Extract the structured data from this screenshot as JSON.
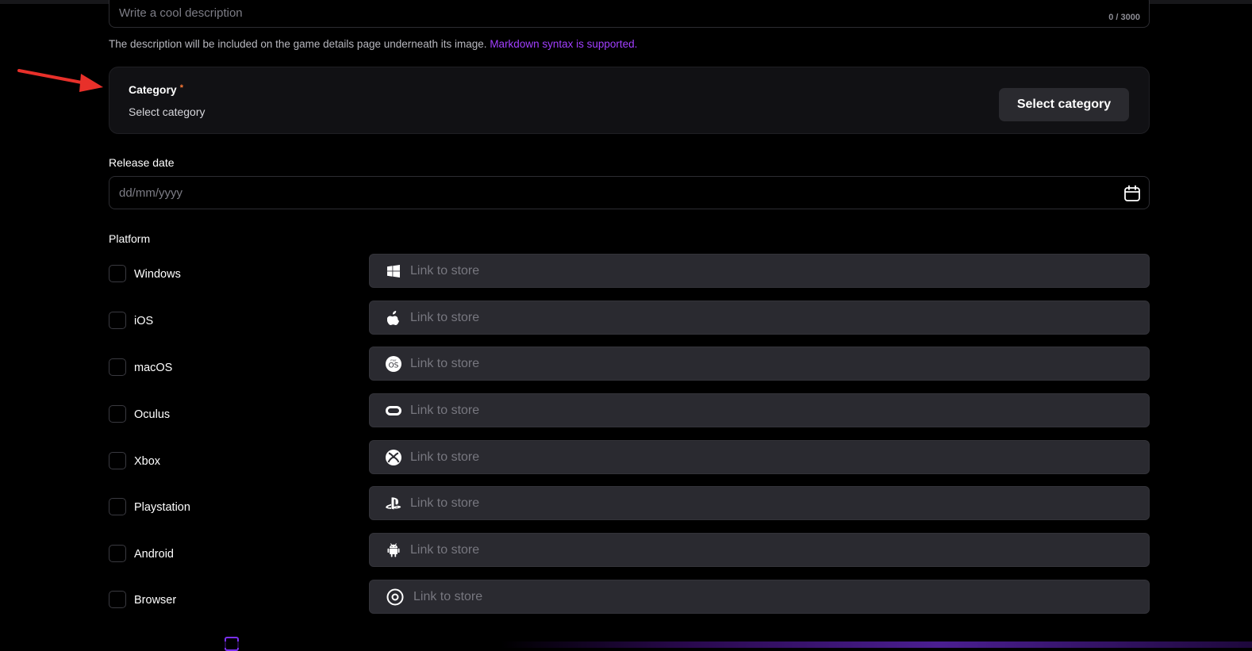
{
  "description": {
    "placeholder": "Write a cool description",
    "counter": "0 / 3000",
    "help_text": "The description will be included on the game details page underneath its image. ",
    "help_link": "Markdown syntax is supported."
  },
  "category": {
    "label": "Category",
    "required_mark": "*",
    "value": "Select category",
    "button_label": "Select category"
  },
  "release_date": {
    "label": "Release date",
    "placeholder": "dd/mm/yyyy"
  },
  "platform": {
    "label": "Platform",
    "items": [
      {
        "name": "Windows",
        "icon": "windows-icon",
        "placeholder": "Link to store"
      },
      {
        "name": "iOS",
        "icon": "apple-icon",
        "placeholder": "Link to store"
      },
      {
        "name": "macOS",
        "icon": "macos-icon",
        "placeholder": "Link to store"
      },
      {
        "name": "Oculus",
        "icon": "oculus-icon",
        "placeholder": "Link to store"
      },
      {
        "name": "Xbox",
        "icon": "xbox-icon",
        "placeholder": "Link to store"
      },
      {
        "name": "Playstation",
        "icon": "playstation-icon",
        "placeholder": "Link to store"
      },
      {
        "name": "Android",
        "icon": "android-icon",
        "placeholder": "Link to store"
      },
      {
        "name": "Browser",
        "icon": "browser-icon",
        "placeholder": "Link to store"
      }
    ]
  },
  "colors": {
    "accent": "#a23fff",
    "required": "#ff7a36",
    "arrow": "#e8302a"
  }
}
